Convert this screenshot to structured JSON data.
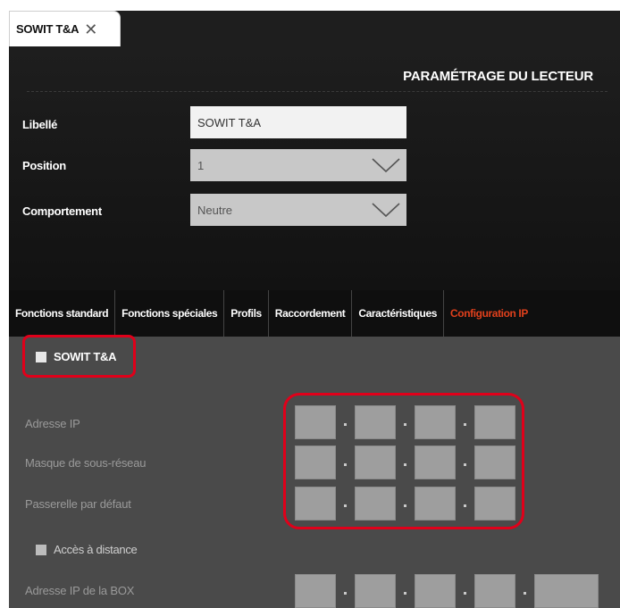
{
  "document_tab": {
    "title": "SOWIT T&A",
    "close_glyph": "✕"
  },
  "header": {
    "title": "PARAMÉTRAGE DU LECTEUR"
  },
  "form": {
    "libelle": {
      "label": "Libellé",
      "value": "SOWIT T&A"
    },
    "position": {
      "label": "Position",
      "value": "1"
    },
    "comportement": {
      "label": "Comportement",
      "value": "Neutre"
    }
  },
  "tabs": [
    {
      "label": "Fonctions standard",
      "active": false
    },
    {
      "label": "Fonctions spéciales",
      "active": false
    },
    {
      "label": "Profils",
      "active": false
    },
    {
      "label": "Raccordement",
      "active": false
    },
    {
      "label": "Caractéristiques",
      "active": false
    },
    {
      "label": "Configuration IP",
      "active": true
    }
  ],
  "ip_config": {
    "enable_checkbox": {
      "label": "SOWIT T&A",
      "checked": false
    },
    "adresse_ip": {
      "label": "Adresse IP",
      "octets": [
        "",
        "",
        "",
        ""
      ]
    },
    "masque": {
      "label": "Masque de sous-réseau",
      "octets": [
        "",
        "",
        "",
        ""
      ]
    },
    "passerelle": {
      "label": "Passerelle par défaut",
      "octets": [
        "",
        "",
        "",
        ""
      ]
    },
    "remote_checkbox": {
      "label": "Accès à distance",
      "checked": false
    },
    "box_ip": {
      "label": "Adresse IP de la BOX",
      "octets": [
        "",
        "",
        "",
        ""
      ],
      "port": ""
    }
  },
  "colors": {
    "active_tab": "#e0401c",
    "highlight": "#e0001a",
    "panel_bg": "#1a1a1a",
    "content_bg": "#4a4a4a"
  }
}
